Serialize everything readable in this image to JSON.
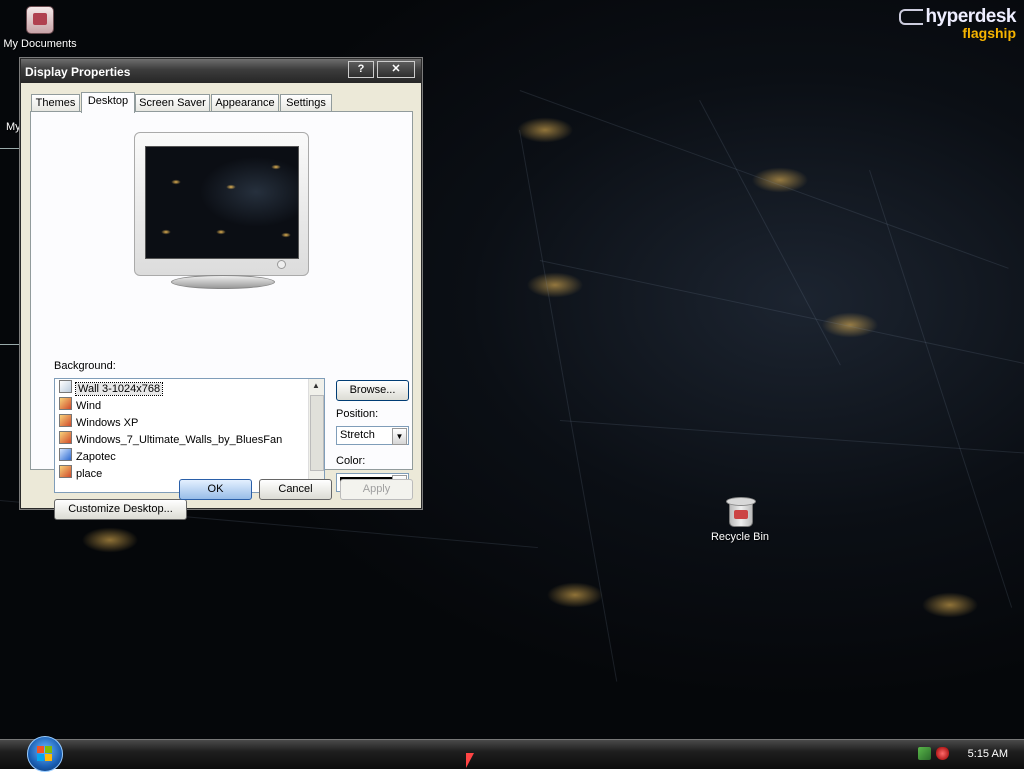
{
  "logo": {
    "brand": "hyperdesk",
    "sub": "flagship"
  },
  "desktop_icons": {
    "my_documents": "My Documents",
    "partial_label": "My",
    "recycle_bin": "Recycle Bin"
  },
  "dialog": {
    "title": "Display Properties",
    "help_btn": "?",
    "close_btn": "✕",
    "tabs": [
      "Themes",
      "Desktop",
      "Screen Saver",
      "Appearance",
      "Settings"
    ],
    "active_tab": "Desktop",
    "background_label": "Background:",
    "background_items": [
      {
        "name": "Wall 3-1024x768",
        "icon": "image-icon",
        "selected": true
      },
      {
        "name": "Wind",
        "icon": "image-icon"
      },
      {
        "name": "Windows XP",
        "icon": "image-icon"
      },
      {
        "name": "Windows_7_Ultimate_Walls_by_BluesFan",
        "icon": "image-icon"
      },
      {
        "name": "Zapotec",
        "icon": "html-icon"
      },
      {
        "name": "place",
        "icon": "image-icon"
      }
    ],
    "browse_btn": "Browse...",
    "position_label": "Position:",
    "position_value": "Stretch",
    "color_label": "Color:",
    "color_value": "#000000",
    "customize_btn": "Customize Desktop...",
    "ok_btn": "OK",
    "cancel_btn": "Cancel",
    "apply_btn": "Apply"
  },
  "taskbar": {
    "clock": "5:15 AM"
  },
  "colors": {
    "accent": "#f6b400",
    "desktop_bg": "#0b0f15",
    "dialog_bg": "#ece9d8"
  }
}
